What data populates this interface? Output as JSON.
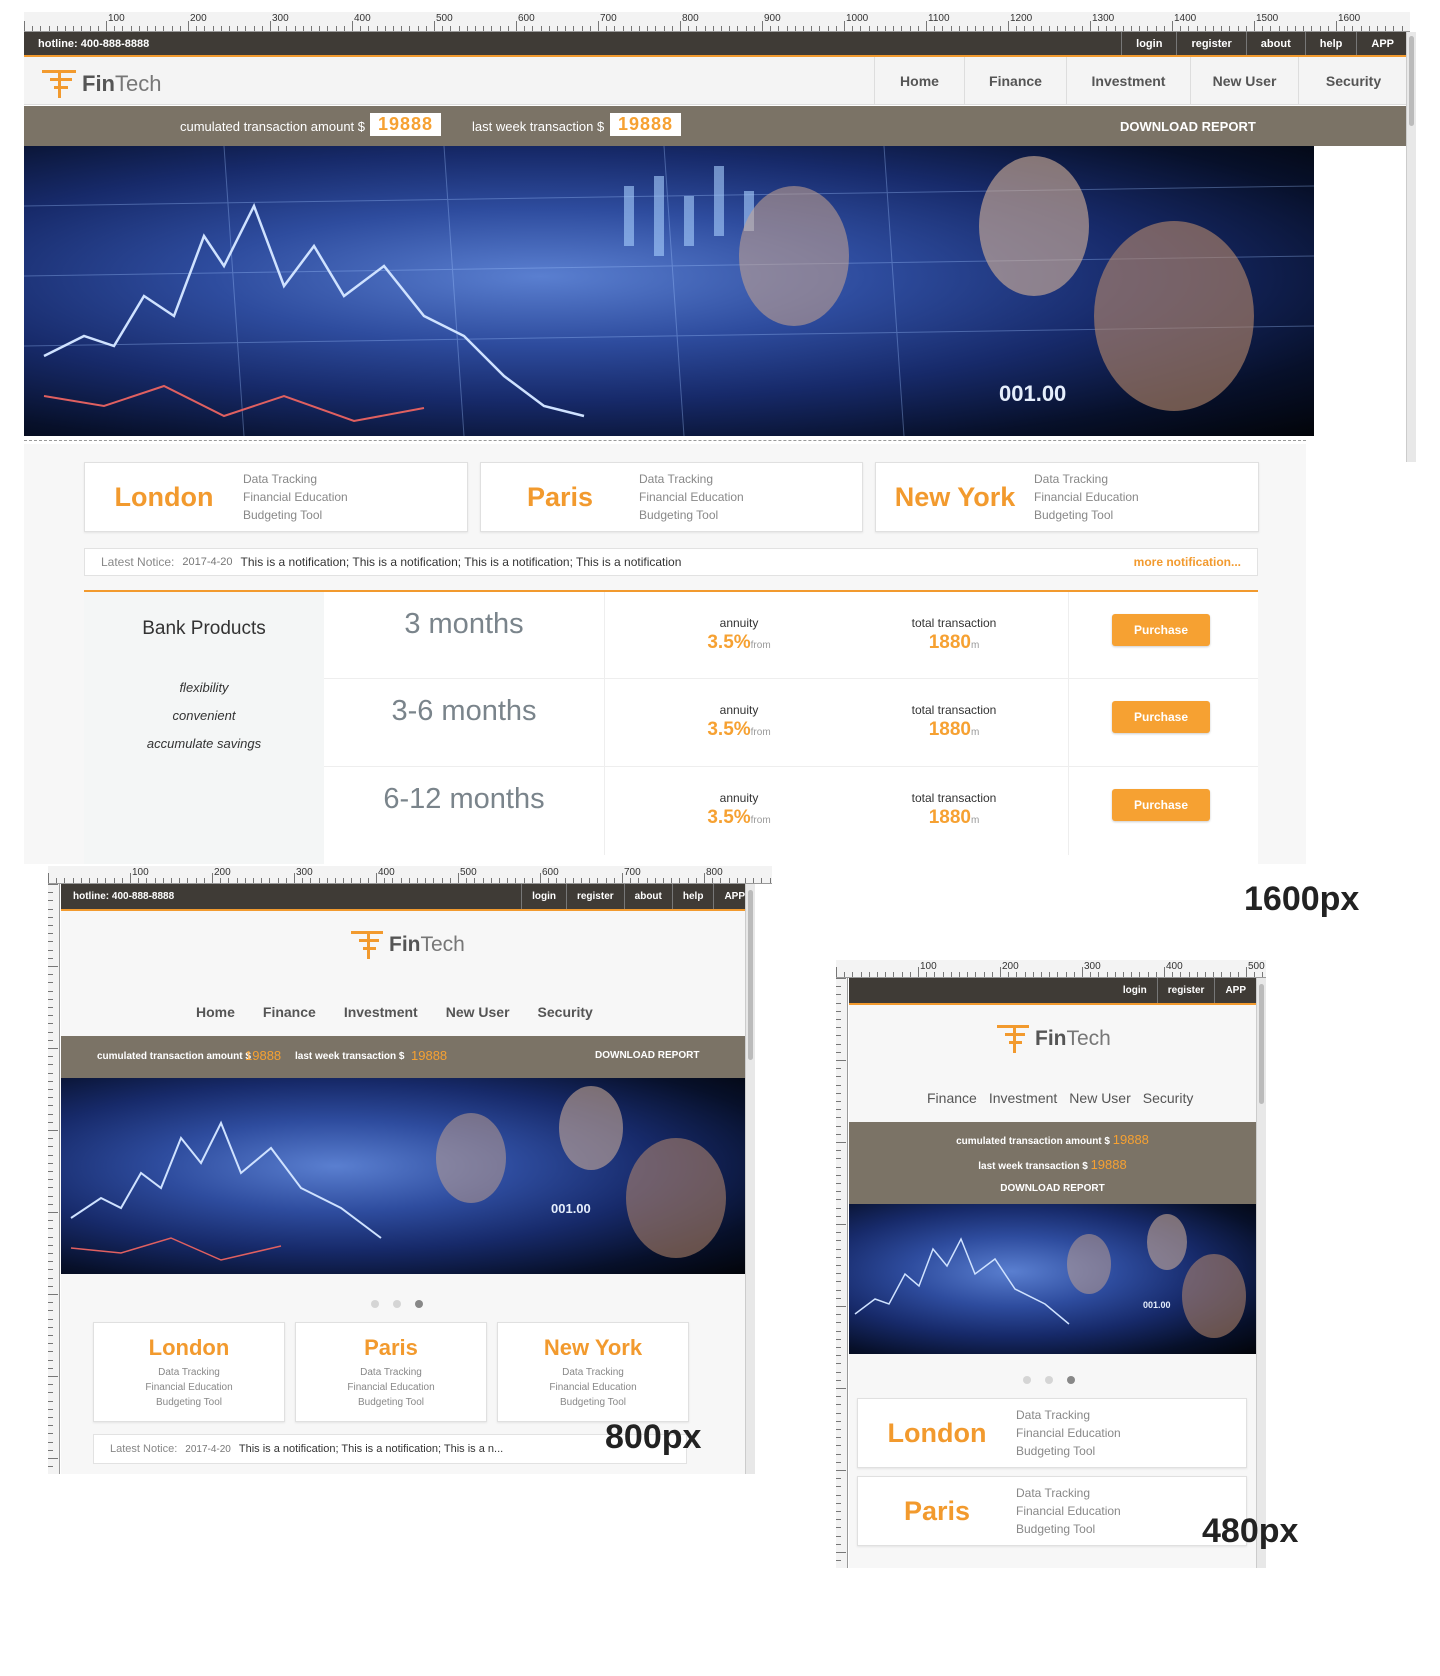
{
  "header": {
    "hotline": "hotline: 400-888-8888",
    "links": [
      "login",
      "register",
      "about",
      "help",
      "APP"
    ]
  },
  "brand": {
    "part1": "Fin",
    "part2": "Tech"
  },
  "nav": [
    "Home",
    "Finance",
    "Investment",
    "New User",
    "Security"
  ],
  "stats": {
    "cumulated_label": "cumulated transaction amount $",
    "cumulated_value": "19888",
    "last_week_label": "last week transaction $",
    "last_week_value": "19888",
    "download": "DOWNLOAD REPORT"
  },
  "cities": [
    {
      "name": "London"
    },
    {
      "name": "Paris"
    },
    {
      "name": "New York"
    }
  ],
  "features": [
    "Data Tracking",
    "Financial Education",
    "Budgeting Tool"
  ],
  "notice": {
    "label": "Latest Notice:",
    "date": "2017-4-20",
    "text": "This is a notification; This is a notification; This is a notification; This is a notification",
    "text_short": "This is a notification; This is a notification; This is a n...",
    "more": "more notification..."
  },
  "bank": {
    "title": "Bank Products",
    "features": [
      "flexibility",
      "convenient",
      "accumulate savings"
    ],
    "annuity_label": "annuity",
    "total_label": "total transaction",
    "from": "from",
    "unit": "m",
    "purchase": "Purchase",
    "rows": [
      {
        "term": "3 months",
        "rate": "3.5%",
        "total": "1880"
      },
      {
        "term": "3-6 months",
        "rate": "3.5%",
        "total": "1880"
      },
      {
        "term": "6-12 months",
        "rate": "3.5%",
        "total": "1880"
      }
    ]
  },
  "labels": {
    "l1600": "1600px",
    "l800": "800px",
    "l480": "480px"
  },
  "colors": {
    "accent": "#f29a2e",
    "topbar": "#3f3b36",
    "statbar": "#7b7366",
    "background": "#f7f7f7"
  }
}
